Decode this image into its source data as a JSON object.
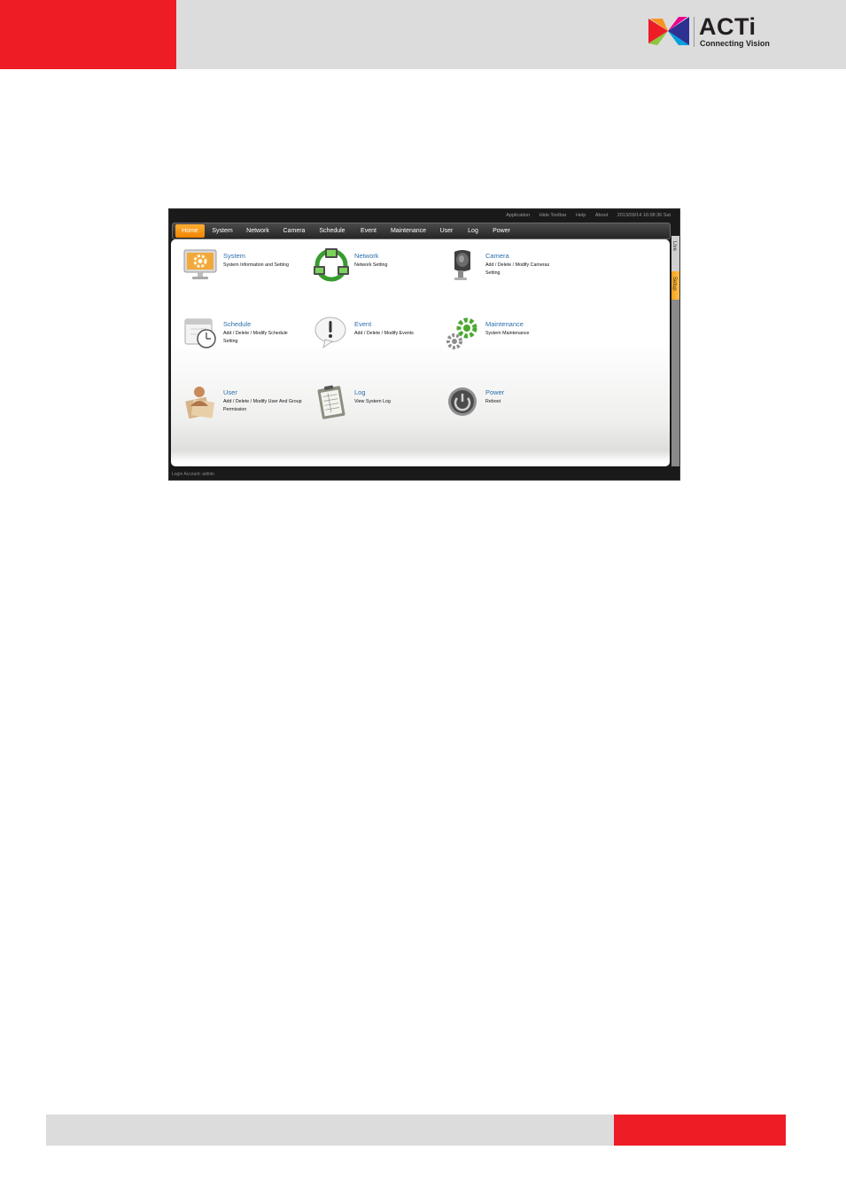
{
  "brand": {
    "name": "ACTi",
    "tagline": "Connecting Vision",
    "accent_red": "#ee1c25",
    "header_gray": "#dcdcdd"
  },
  "top_links": [
    "Application",
    "Hide Toolbar",
    "Help",
    "About",
    "2013/09/14 16:08:36 Sat"
  ],
  "menu": {
    "items": [
      "Home",
      "System",
      "Network",
      "Camera",
      "Schedule",
      "Event",
      "Maintenance",
      "User",
      "Log",
      "Power"
    ],
    "active": "Home",
    "active_color": "#f7941d"
  },
  "tiles": [
    {
      "title": "System",
      "desc": "System Information and Setting",
      "icon": "monitor-gear-icon"
    },
    {
      "title": "Network",
      "desc": "Network Setting",
      "icon": "network-computers-icon"
    },
    {
      "title": "Camera",
      "desc": "Add / Delete / Modify Cameras Setting",
      "icon": "camera-icon"
    },
    {
      "title": "Schedule",
      "desc": "Add / Delete / Modify Schedule Setting",
      "icon": "calendar-clock-icon"
    },
    {
      "title": "Event",
      "desc": "Add / Delete / Modify Events",
      "icon": "exclamation-bubble-icon"
    },
    {
      "title": "Maintenance",
      "desc": "System Maintenance",
      "icon": "gears-icon"
    },
    {
      "title": "User",
      "desc": "Add / Delete / Modify User And Group Permission",
      "icon": "user-papers-icon"
    },
    {
      "title": "Log",
      "desc": "View System Log",
      "icon": "clipboard-log-icon"
    },
    {
      "title": "Power",
      "desc": "Reboot",
      "icon": "power-button-icon"
    }
  ],
  "side_tabs": {
    "live": "Live",
    "setup": "Setup"
  },
  "status": "Login Account: admin"
}
